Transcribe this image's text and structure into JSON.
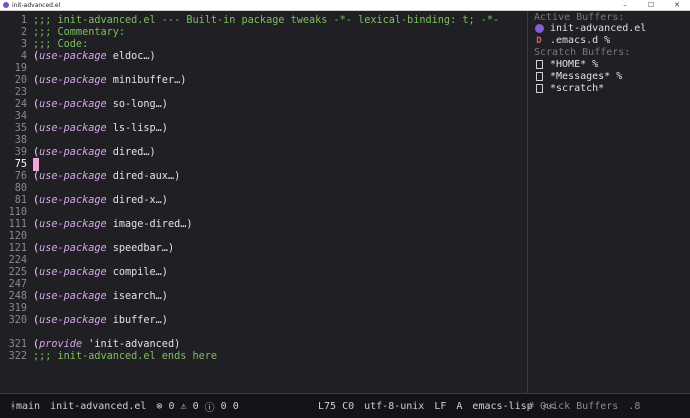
{
  "window": {
    "title": "init-advanced.el",
    "controls": [
      "–",
      "☐",
      "✕"
    ]
  },
  "editor": {
    "lines": [
      {
        "num": "1",
        "parts": [
          {
            "t": ";;; init-advanced.el --- Built-in package tweaks -*- lexical-binding: t; -*-",
            "c": "comment"
          }
        ]
      },
      {
        "num": "2",
        "parts": [
          {
            "t": ";;; Commentary:",
            "c": "comment"
          }
        ]
      },
      {
        "num": "3",
        "parts": [
          {
            "t": ";;; Code:",
            "c": "comment"
          }
        ]
      },
      {
        "num": "4",
        "parts": [
          {
            "t": "(",
            "c": "code"
          },
          {
            "t": "use-package",
            "c": "kw"
          },
          {
            "t": " eldoc…)",
            "c": "fold"
          }
        ]
      },
      {
        "num": "19",
        "parts": []
      },
      {
        "num": "20",
        "parts": [
          {
            "t": "(",
            "c": "code"
          },
          {
            "t": "use-package",
            "c": "kw"
          },
          {
            "t": " minibuffer…)",
            "c": "fold"
          }
        ]
      },
      {
        "num": "23",
        "parts": []
      },
      {
        "num": "24",
        "parts": [
          {
            "t": "(",
            "c": "code"
          },
          {
            "t": "use-package",
            "c": "kw"
          },
          {
            "t": " so-long…)",
            "c": "fold"
          }
        ]
      },
      {
        "num": "34",
        "parts": []
      },
      {
        "num": "35",
        "parts": [
          {
            "t": "(",
            "c": "code"
          },
          {
            "t": "use-package",
            "c": "kw"
          },
          {
            "t": " ls-lisp…)",
            "c": "fold"
          }
        ]
      },
      {
        "num": "38",
        "parts": []
      },
      {
        "num": "39",
        "parts": [
          {
            "t": "(",
            "c": "code"
          },
          {
            "t": "use-package",
            "c": "kw"
          },
          {
            "t": " dired…)",
            "c": "fold"
          }
        ]
      },
      {
        "num": "75",
        "parts": [],
        "current": true
      },
      {
        "num": "76",
        "parts": [
          {
            "t": "(",
            "c": "code"
          },
          {
            "t": "use-package",
            "c": "kw"
          },
          {
            "t": " dired-aux…)",
            "c": "fold"
          }
        ]
      },
      {
        "num": "80",
        "parts": []
      },
      {
        "num": "81",
        "parts": [
          {
            "t": "(",
            "c": "code"
          },
          {
            "t": "use-package",
            "c": "kw"
          },
          {
            "t": " dired-x…)",
            "c": "fold"
          }
        ]
      },
      {
        "num": "110",
        "parts": []
      },
      {
        "num": "111",
        "parts": [
          {
            "t": "(",
            "c": "code"
          },
          {
            "t": "use-package",
            "c": "kw"
          },
          {
            "t": " image-dired…)",
            "c": "fold"
          }
        ]
      },
      {
        "num": "120",
        "parts": []
      },
      {
        "num": "121",
        "parts": [
          {
            "t": "(",
            "c": "code"
          },
          {
            "t": "use-package",
            "c": "kw"
          },
          {
            "t": " speedbar…)",
            "c": "fold"
          }
        ]
      },
      {
        "num": "224",
        "parts": []
      },
      {
        "num": "225",
        "parts": [
          {
            "t": "(",
            "c": "code"
          },
          {
            "t": "use-package",
            "c": "kw"
          },
          {
            "t": " compile…)",
            "c": "fold"
          }
        ]
      },
      {
        "num": "247",
        "parts": []
      },
      {
        "num": "248",
        "parts": [
          {
            "t": "(",
            "c": "code"
          },
          {
            "t": "use-package",
            "c": "kw"
          },
          {
            "t": " isearch…)",
            "c": "fold"
          }
        ]
      },
      {
        "num": "319",
        "parts": []
      },
      {
        "num": "320",
        "parts": [
          {
            "t": "(",
            "c": "code"
          },
          {
            "t": "use-package",
            "c": "kw"
          },
          {
            "t": " ibuffer…)",
            "c": "fold"
          }
        ]
      },
      {
        "num": "",
        "parts": []
      },
      {
        "num": "321",
        "parts": [
          {
            "t": "(",
            "c": "code"
          },
          {
            "t": "provide",
            "c": "kw"
          },
          {
            "t": " 'init-advanced)",
            "c": "code"
          }
        ]
      },
      {
        "num": "322",
        "parts": [
          {
            "t": ";;; init-advanced.el ends here",
            "c": "comment"
          }
        ]
      }
    ]
  },
  "sidebar": {
    "active_header": "Active Buffers:",
    "active": [
      {
        "label": "init-advanced.el",
        "icon": "emacs-icon"
      },
      {
        "label": ".emacs.d %",
        "icon": "dired-icon"
      }
    ],
    "scratch_header": "Scratch Buffers:",
    "scratch": [
      {
        "label": "*HOME* %",
        "icon": "file-icon"
      },
      {
        "label": "*Messages* %",
        "icon": "file-icon"
      },
      {
        "label": "*scratch*",
        "icon": "file-icon"
      }
    ]
  },
  "modeline": {
    "branch_icon": "ᚼ",
    "branch": "main",
    "file": "init-advanced.el",
    "errors": "0",
    "warnings": "0",
    "infos": "0",
    "extra": "0",
    "position": "L75 C0",
    "encoding": "utf-8-unix",
    "eol": "LF",
    "indicator": "A",
    "mode": "emacs-lisp",
    "nav": "<<",
    "quick": "# Quick Buffers",
    "quick_num": ".8"
  }
}
